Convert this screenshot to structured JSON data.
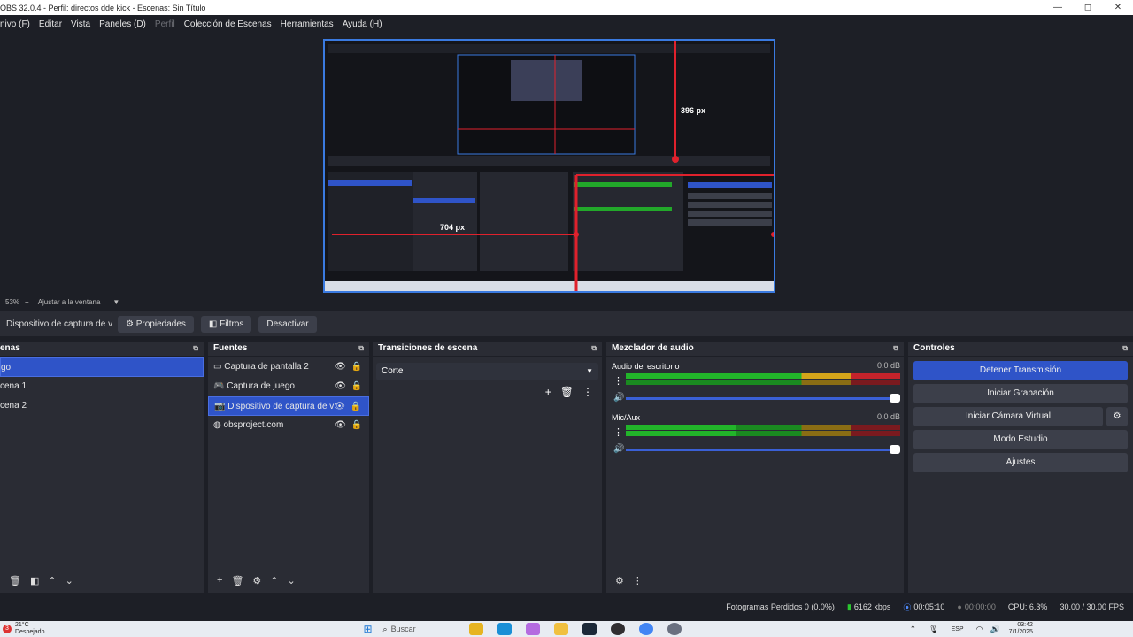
{
  "title_bar": {
    "title": "OBS 32.0.4 - Perfil: directos dde kick - Escenas: Sin Título",
    "minimize": "—",
    "maximize": "◻",
    "close": "✕"
  },
  "menu": {
    "items": [
      "nivo (F)",
      "Editar",
      "Vista",
      "Paneles (D)",
      "Perfil",
      "Colección de Escenas",
      "Herramientas",
      "Ayuda (H)"
    ]
  },
  "preview": {
    "label_396": "396 px",
    "label_704": "704 px"
  },
  "zoom": {
    "percent": "53%",
    "fit": "Ajustar a la ventana"
  },
  "source_bar": {
    "name": "Dispositivo de captura de v",
    "properties": "Propiedades",
    "filters": "Filtros",
    "deactivate": "Desactivar"
  },
  "scenes": {
    "title": "enas",
    "items": [
      "go",
      "cena 1",
      "cena 2"
    ]
  },
  "sources": {
    "title": "Fuentes",
    "items": [
      "Captura de pantalla 2",
      "Captura de juego",
      "Dispositivo de captura de v",
      "obsproject.com"
    ]
  },
  "transitions": {
    "title": "Transiciones de escena",
    "selected": "Corte"
  },
  "mixer": {
    "title": "Mezclador de audio",
    "channels": [
      {
        "name": "Audio del escritorio",
        "db": "0.0 dB"
      },
      {
        "name": "Mic/Aux",
        "db": "0.0 dB"
      }
    ],
    "scale": [
      "-60",
      "-55",
      "-50",
      "-45",
      "-40",
      "-35",
      "-30",
      "-25",
      "-20",
      "-15",
      "-10",
      "-5",
      "0"
    ]
  },
  "controls": {
    "title": "Controles",
    "stop_stream": "Detener Transmisión",
    "start_record": "Iniciar Grabación",
    "virtual_cam": "Iniciar Cámara Virtual",
    "studio_mode": "Modo Estudio",
    "settings": "Ajustes"
  },
  "status": {
    "dropped": "Fotogramas Perdidos 0 (0.0%)",
    "bitrate": "6162 kbps",
    "live_time": "00:05:10",
    "rec_time": "00:00:00",
    "cpu": "CPU: 6.3%",
    "fps": "30.00 / 30.00 FPS"
  },
  "taskbar": {
    "weather": "21°C",
    "weather_sub": "Despejado",
    "search": "Buscar",
    "lang": "ESP",
    "time": "03:42",
    "date": "7/1/2025",
    "badge": "3"
  },
  "colors": {
    "accent": "#2f54c8",
    "panel": "#2a2c34",
    "bg": "#1d1f26"
  }
}
